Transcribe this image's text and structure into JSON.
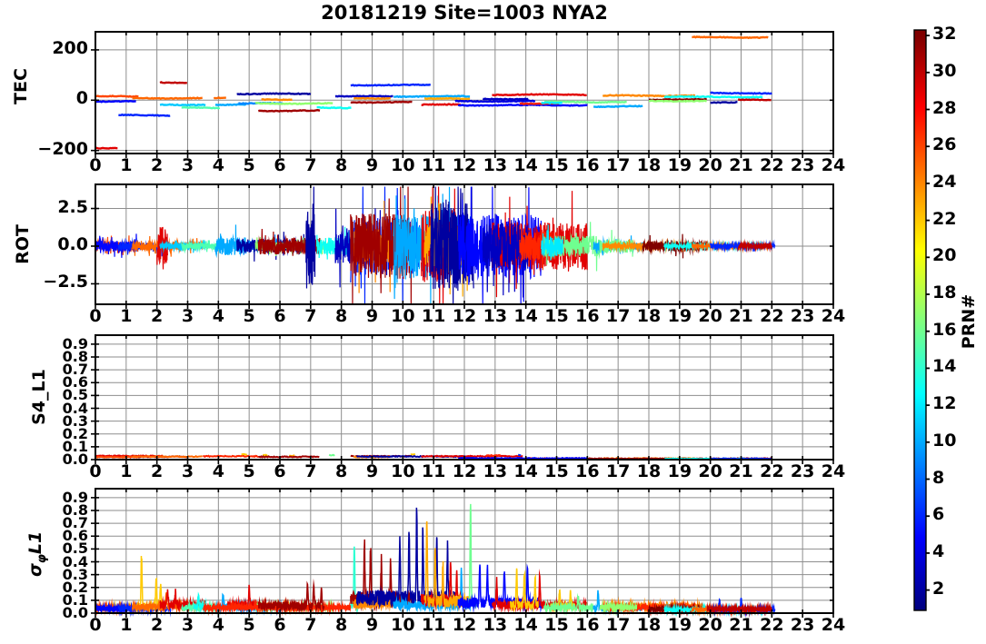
{
  "title": "20181219 Site=1003 NYA2",
  "x_axis": {
    "label": "",
    "ticks": [
      0,
      1,
      2,
      3,
      4,
      5,
      6,
      7,
      8,
      9,
      10,
      11,
      12,
      13,
      14,
      15,
      16,
      17,
      18,
      19,
      20,
      21,
      22,
      23,
      24
    ],
    "xlim": [
      0,
      24
    ]
  },
  "colorbar": {
    "label": "PRN#",
    "colormap": "jet",
    "vmin": 0.9,
    "vmax": 32.3,
    "ticks": [
      2,
      4,
      6,
      8,
      10,
      12,
      14,
      16,
      18,
      20,
      22,
      24,
      26,
      28,
      30,
      32
    ]
  },
  "chart_data": [
    {
      "id": "tec",
      "type": "line",
      "ylabel": "TEC",
      "xlim": [
        0,
        24
      ],
      "ylim": [
        -212,
        272
      ],
      "yticks": [
        200,
        0,
        -200
      ],
      "ytick_labels": [
        "200",
        "0",
        "−200"
      ],
      "grid_y": [
        200,
        0,
        -200
      ],
      "segment_format": [
        "prn",
        "t_start_hour",
        "t_end_hour",
        "tec_value"
      ],
      "segments": [
        [
          29,
          0.0,
          0.75,
          -190
        ],
        [
          26,
          0.0,
          1.4,
          15
        ],
        [
          5,
          0.0,
          1.35,
          -5
        ],
        [
          25,
          1.2,
          3.5,
          8
        ],
        [
          6,
          0.75,
          2.45,
          -60
        ],
        [
          30,
          2.1,
          3.0,
          70
        ],
        [
          11,
          2.1,
          3.6,
          -18
        ],
        [
          15,
          2.8,
          4.05,
          -30
        ],
        [
          25,
          3.85,
          4.25,
          8
        ],
        [
          10,
          3.9,
          4.9,
          -18
        ],
        [
          9,
          4.65,
          6.1,
          -13
        ],
        [
          2,
          4.6,
          7.0,
          25
        ],
        [
          24,
          5.4,
          6.4,
          3
        ],
        [
          17,
          5.2,
          7.75,
          -13
        ],
        [
          31,
          5.3,
          7.3,
          -42
        ],
        [
          13,
          7.2,
          8.35,
          -30
        ],
        [
          3,
          7.8,
          9.7,
          15
        ],
        [
          6,
          8.3,
          10.9,
          60
        ],
        [
          24,
          8.4,
          9.6,
          8
        ],
        [
          31,
          8.3,
          10.3,
          -8
        ],
        [
          10,
          9.7,
          12.2,
          15
        ],
        [
          23,
          10.7,
          12.2,
          5
        ],
        [
          29,
          10.6,
          11.9,
          -18
        ],
        [
          5,
          11.8,
          16.0,
          -20
        ],
        [
          4,
          11.7,
          14.3,
          -4
        ],
        [
          29,
          12.9,
          16.0,
          22
        ],
        [
          3,
          12.6,
          14.1,
          5
        ],
        [
          27,
          13.8,
          15.1,
          -13
        ],
        [
          16,
          14.6,
          17.3,
          -7
        ],
        [
          12,
          14.5,
          15.2,
          -10
        ],
        [
          10,
          16.2,
          17.8,
          -25
        ],
        [
          24,
          16.5,
          19.5,
          18
        ],
        [
          13,
          18.5,
          21.7,
          13
        ],
        [
          32,
          18.0,
          19.9,
          2
        ],
        [
          17,
          18.0,
          19.9,
          -3
        ],
        [
          25,
          19.4,
          21.9,
          250
        ],
        [
          6,
          20.0,
          22.0,
          28
        ],
        [
          2,
          20.0,
          20.9,
          -8
        ],
        [
          30,
          20.9,
          22.0,
          2
        ]
      ]
    },
    {
      "id": "rot",
      "type": "line",
      "ylabel": "ROT",
      "xlim": [
        0,
        24
      ],
      "ylim": [
        -3.86,
        4.1
      ],
      "yticks": [
        2.5,
        0,
        -2.5
      ],
      "ytick_labels": [
        "2.5",
        "0.0",
        "−2.5"
      ],
      "grid_y": [
        2.5,
        0,
        -2.5
      ],
      "burst_format": [
        "prn",
        "t_start_hour",
        "t_end_hour",
        "noise_amplitude"
      ],
      "bursts": [
        [
          26,
          0.0,
          1.4,
          0.3
        ],
        [
          5,
          0.0,
          1.35,
          0.35
        ],
        [
          6,
          0.75,
          2.45,
          0.3
        ],
        [
          25,
          1.2,
          3.5,
          0.3
        ],
        [
          29,
          2.0,
          2.35,
          1.3
        ],
        [
          11,
          2.1,
          3.6,
          0.2
        ],
        [
          15,
          2.8,
          4.05,
          0.2
        ],
        [
          10,
          3.9,
          4.9,
          0.6
        ],
        [
          9,
          4.65,
          6.1,
          0.35
        ],
        [
          2,
          4.6,
          7.0,
          0.45
        ],
        [
          17,
          5.2,
          7.75,
          0.3
        ],
        [
          31,
          5.3,
          7.3,
          0.55
        ],
        [
          2,
          6.85,
          7.15,
          2.9
        ],
        [
          13,
          7.2,
          8.35,
          0.6
        ],
        [
          3,
          7.8,
          9.7,
          1.2
        ],
        [
          6,
          8.3,
          10.9,
          1.9
        ],
        [
          24,
          8.4,
          9.6,
          1.3
        ],
        [
          31,
          8.3,
          10.3,
          2.2
        ],
        [
          10,
          9.7,
          12.2,
          2.1
        ],
        [
          29,
          10.6,
          11.9,
          2.4
        ],
        [
          23,
          10.7,
          12.2,
          1.4
        ],
        [
          2,
          10.9,
          12.3,
          3.0
        ],
        [
          5,
          11.8,
          14.5,
          2.1
        ],
        [
          29,
          12.9,
          16.0,
          1.6
        ],
        [
          3,
          12.6,
          14.1,
          1.5
        ],
        [
          27,
          13.8,
          15.1,
          1.0
        ],
        [
          16,
          14.6,
          16.4,
          0.7
        ],
        [
          12,
          14.5,
          15.2,
          0.7
        ],
        [
          10,
          16.2,
          17.8,
          0.3
        ],
        [
          16,
          16.4,
          17.5,
          0.45
        ],
        [
          24,
          16.5,
          19.5,
          0.22
        ],
        [
          32,
          17.8,
          19.9,
          0.35
        ],
        [
          13,
          18.5,
          21.7,
          0.12
        ],
        [
          25,
          19.4,
          21.9,
          0.12
        ],
        [
          6,
          20.0,
          22.1,
          0.15
        ],
        [
          30,
          20.9,
          22.0,
          0.18
        ]
      ]
    },
    {
      "id": "s4",
      "type": "line",
      "ylabel": "S4_L1",
      "xlim": [
        0,
        24
      ],
      "ylim": [
        0,
        0.97
      ],
      "yticks": [
        0.0,
        0.1,
        0.2,
        0.3,
        0.4,
        0.5,
        0.6,
        0.7,
        0.8,
        0.9
      ],
      "ytick_labels": [
        "0.0",
        "0.1",
        "0.2",
        "0.3",
        "0.4",
        "0.5",
        "0.6",
        "0.7",
        "0.8",
        "0.9"
      ],
      "grid_y": [
        0.1,
        0.2,
        0.3,
        0.4,
        0.5,
        0.6,
        0.7,
        0.8,
        0.9
      ],
      "segment_format": [
        "prn",
        "t_start_hour",
        "t_end_hour",
        "s4_value"
      ],
      "segments": [
        [
          31,
          0.0,
          3.0,
          0.022
        ],
        [
          29,
          0.0,
          2.2,
          0.028
        ],
        [
          26,
          0.0,
          1.4,
          0.02
        ],
        [
          25,
          1.2,
          3.5,
          0.024
        ],
        [
          27,
          3.5,
          5.3,
          0.026
        ],
        [
          22,
          4.75,
          4.95,
          0.04
        ],
        [
          22,
          5.45,
          5.6,
          0.035
        ],
        [
          23,
          6.3,
          6.5,
          0.03
        ],
        [
          31,
          5.3,
          7.3,
          0.022
        ],
        [
          16,
          7.6,
          7.8,
          0.035
        ],
        [
          31,
          8.3,
          10.3,
          0.026
        ],
        [
          24,
          8.4,
          9.6,
          0.02
        ],
        [
          22,
          10.25,
          10.4,
          0.04
        ],
        [
          2,
          8.5,
          12.3,
          0.024
        ],
        [
          29,
          10.6,
          13.9,
          0.026
        ],
        [
          27,
          12.7,
          13.2,
          0.032
        ],
        [
          6,
          13.75,
          13.85,
          0.035
        ],
        [
          29,
          13.9,
          16.0,
          0.008
        ],
        [
          24,
          16.5,
          19.5,
          0.009
        ],
        [
          31,
          16.0,
          19.9,
          0.007
        ],
        [
          30,
          19.9,
          22.0,
          0.008
        ],
        [
          13,
          18.5,
          21.7,
          0.006
        ],
        [
          5,
          11.8,
          16.0,
          0.01
        ],
        [
          6,
          20.0,
          22.0,
          0.007
        ]
      ]
    },
    {
      "id": "sig",
      "type": "line",
      "ylabel": "σφL1",
      "ylabel_parts": {
        "sigma": "σ",
        "phi": "φ",
        "rest": "L1"
      },
      "xlim": [
        0,
        24
      ],
      "ylim": [
        0,
        0.97
      ],
      "yticks": [
        0.0,
        0.1,
        0.2,
        0.3,
        0.4,
        0.5,
        0.6,
        0.7,
        0.8,
        0.9
      ],
      "ytick_labels": [
        "0.0",
        "0.1",
        "0.2",
        "0.3",
        "0.4",
        "0.5",
        "0.6",
        "0.7",
        "0.8",
        "0.9"
      ],
      "grid_y": [
        0.1,
        0.2,
        0.3,
        0.4,
        0.5,
        0.6,
        0.7,
        0.8,
        0.9
      ],
      "burst_format": [
        "prn",
        "t_start_hour",
        "t_end_hour",
        "baseline",
        "spikes[t,peak]"
      ],
      "bursts": [
        [
          22,
          0.0,
          1.3,
          0.045,
          []
        ],
        [
          26,
          0.0,
          1.4,
          0.05,
          []
        ],
        [
          5,
          0.0,
          1.35,
          0.04,
          []
        ],
        [
          6,
          0.75,
          2.45,
          0.04,
          []
        ],
        [
          22,
          1.3,
          2.3,
          0.06,
          [
            [
              1.5,
              0.46
            ],
            [
              1.98,
              0.27
            ],
            [
              2.12,
              0.22
            ]
          ]
        ],
        [
          25,
          1.2,
          3.5,
          0.055,
          [
            [
              2.3,
              0.12
            ]
          ]
        ],
        [
          29,
          2.1,
          3.6,
          0.075,
          [
            [
              2.35,
              0.14
            ],
            [
              2.6,
              0.1
            ]
          ]
        ],
        [
          15,
          2.8,
          4.05,
          0.05,
          []
        ],
        [
          13,
          3.2,
          3.6,
          0.055,
          [
            [
              3.35,
              0.1
            ]
          ]
        ],
        [
          10,
          3.9,
          4.9,
          0.055,
          [
            [
              4.15,
              0.12
            ]
          ]
        ],
        [
          9,
          4.65,
          6.1,
          0.05,
          []
        ],
        [
          29,
          4.3,
          5.3,
          0.07,
          [
            [
              5.0,
              0.16
            ]
          ]
        ],
        [
          17,
          5.2,
          7.75,
          0.05,
          []
        ],
        [
          26,
          5.4,
          6.6,
          0.06,
          []
        ],
        [
          27,
          3.5,
          8.3,
          0.05,
          []
        ],
        [
          31,
          5.3,
          7.45,
          0.065,
          [
            [
              6.9,
              0.19
            ],
            [
              7.1,
              0.17
            ],
            [
              7.35,
              0.14
            ]
          ]
        ],
        [
          14,
          8.3,
          8.55,
          0.06,
          [
            [
              8.42,
              0.55
            ]
          ]
        ],
        [
          31,
          8.3,
          10.3,
          0.12,
          [
            [
              8.75,
              0.45
            ],
            [
              8.95,
              0.42
            ],
            [
              9.3,
              0.34
            ],
            [
              9.6,
              0.3
            ]
          ]
        ],
        [
          24,
          8.4,
          9.6,
          0.08,
          []
        ],
        [
          2,
          8.5,
          11.7,
          0.13,
          [
            [
              9.9,
              0.48
            ],
            [
              10.2,
              0.55
            ],
            [
              10.45,
              0.74
            ],
            [
              10.65,
              0.6
            ],
            [
              11.1,
              0.52
            ],
            [
              11.45,
              0.42
            ]
          ]
        ],
        [
          10,
          9.7,
          12.2,
          0.07,
          [
            [
              11.9,
              0.28
            ]
          ]
        ],
        [
          29,
          10.6,
          11.9,
          0.11,
          [
            [
              11.55,
              0.3
            ],
            [
              11.75,
              0.26
            ]
          ]
        ],
        [
          23,
          10.7,
          12.2,
          0.1,
          [
            [
              10.78,
              0.72
            ],
            [
              11.05,
              0.4
            ],
            [
              11.3,
              0.33
            ]
          ]
        ],
        [
          16,
          12.05,
          12.4,
          0.08,
          [
            [
              12.2,
              0.92
            ]
          ]
        ],
        [
          5,
          11.8,
          14.5,
          0.09,
          [
            [
              12.5,
              0.34
            ],
            [
              12.75,
              0.3
            ],
            [
              13.3,
              0.29
            ],
            [
              14.05,
              0.31
            ]
          ]
        ],
        [
          29,
          12.9,
          16.0,
          0.07,
          [
            [
              13.05,
              0.2
            ],
            [
              14.45,
              0.24
            ]
          ]
        ],
        [
          22,
          13.5,
          14.4,
          0.07,
          [
            [
              13.7,
              0.3
            ],
            [
              13.95,
              0.27
            ],
            [
              14.3,
              0.24
            ]
          ]
        ],
        [
          22,
          14.8,
          15.6,
          0.06,
          [
            [
              15.1,
              0.16
            ],
            [
              15.45,
              0.13
            ]
          ]
        ],
        [
          16,
          14.6,
          16.2,
          0.05,
          [
            [
              15.7,
              0.11
            ]
          ]
        ],
        [
          10,
          16.2,
          17.8,
          0.045,
          [
            [
              16.35,
              0.14
            ]
          ]
        ],
        [
          24,
          16.5,
          19.8,
          0.06,
          []
        ],
        [
          27,
          16.5,
          19.5,
          0.05,
          []
        ],
        [
          17,
          16.4,
          17.6,
          0.05,
          []
        ],
        [
          32,
          18.0,
          19.9,
          0.035,
          []
        ],
        [
          13,
          18.5,
          21.7,
          0.03,
          []
        ],
        [
          25,
          19.4,
          21.9,
          0.03,
          []
        ],
        [
          6,
          20.0,
          22.1,
          0.03,
          [
            [
              20.3,
              0.09
            ],
            [
              21.0,
              0.1
            ]
          ]
        ],
        [
          30,
          19.9,
          22.0,
          0.035,
          []
        ]
      ]
    }
  ]
}
